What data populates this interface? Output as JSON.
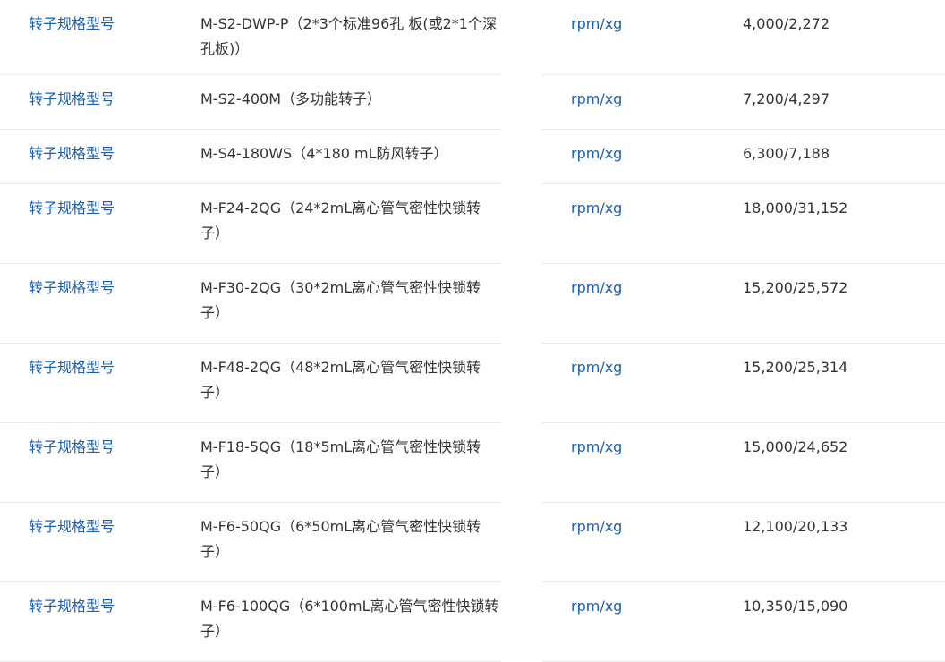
{
  "rows": [
    {
      "label": "转子规格型号",
      "model": "M-S2-DWP-P（2*3个标准96孔 板(或2*1个深孔板)）",
      "unit": "rpm/xg",
      "value": "4,000/2,272"
    },
    {
      "label": "转子规格型号",
      "model": "M-S2-400M（多功能转子）",
      "unit": "rpm/xg",
      "value": "7,200/4,297"
    },
    {
      "label": "转子规格型号",
      "model": "M-S4-180WS（4*180 mL防风转子）",
      "unit": "rpm/xg",
      "value": "6,300/7,188"
    },
    {
      "label": "转子规格型号",
      "model": "M-F24-2QG（24*2mL离心管气密性快锁转子）",
      "unit": "rpm/xg",
      "value": "18,000/31,152"
    },
    {
      "label": "转子规格型号",
      "model": "M-F30-2QG（30*2mL离心管气密性快锁转子）",
      "unit": "rpm/xg",
      "value": "15,200/25,572"
    },
    {
      "label": "转子规格型号",
      "model": "M-F48-2QG（48*2mL离心管气密性快锁转子）",
      "unit": "rpm/xg",
      "value": "15,200/25,314"
    },
    {
      "label": "转子规格型号",
      "model": "M-F18-5QG（18*5mL离心管气密性快锁转子）",
      "unit": "rpm/xg",
      "value": "15,000/24,652"
    },
    {
      "label": "转子规格型号",
      "model": "M-F6-50QG（6*50mL离心管气密性快锁转子）",
      "unit": "rpm/xg",
      "value": "12,100/20,133"
    },
    {
      "label": "转子规格型号",
      "model": "M-F6-100QG（6*100mL离心管气密性快锁转子）",
      "unit": "rpm/xg",
      "value": "10,350/15,090"
    }
  ]
}
